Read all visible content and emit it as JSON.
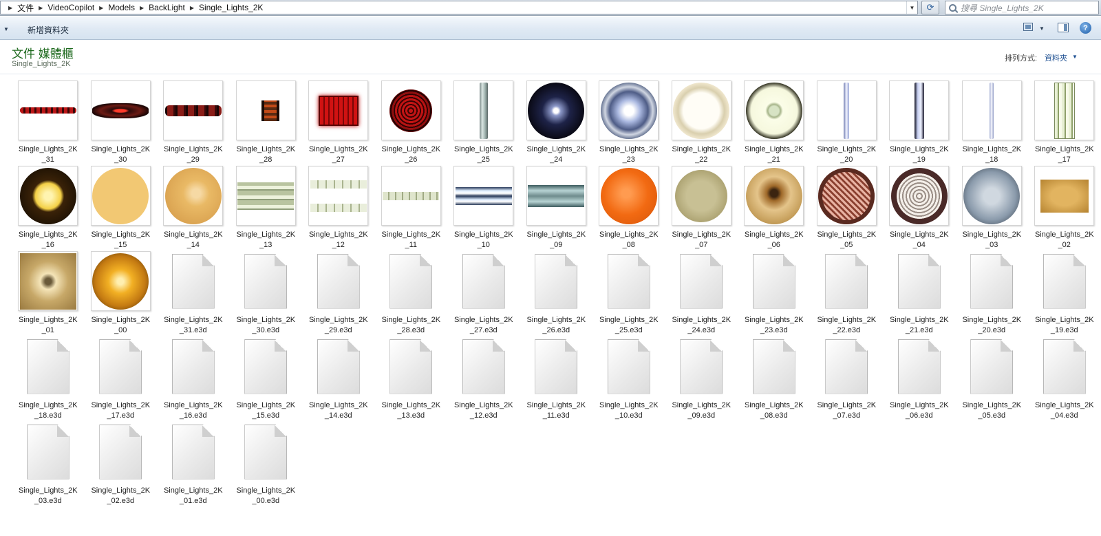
{
  "address_bar": {
    "crumbs": [
      "文件",
      "VideoCopilot",
      "Models",
      "BackLight",
      "Single_Lights_2K"
    ],
    "search_placeholder": "搜尋 Single_Lights_2K"
  },
  "toolbar": {
    "new_folder_label": "新增資料夾"
  },
  "library": {
    "title": "文件 媒體櫃",
    "subtitle": "Single_Lights_2K",
    "arrange_label": "排列方式:",
    "arrange_value": "資料夾"
  },
  "files": [
    {
      "label": "Single_Lights_2K\n_31",
      "thumb": "bar-red-dots"
    },
    {
      "label": "Single_Lights_2K\n_30",
      "thumb": "bar-red-oval"
    },
    {
      "label": "Single_Lights_2K\n_29",
      "thumb": "bar-red-segments"
    },
    {
      "label": "Single_Lights_2K\n_28",
      "thumb": "small-red-block"
    },
    {
      "label": "Single_Lights_2K\n_27",
      "thumb": "red-panel"
    },
    {
      "label": "Single_Lights_2K\n_26",
      "thumb": "red-circle"
    },
    {
      "label": "Single_Lights_2K\n_25",
      "thumb": "tube-vertical-teal"
    },
    {
      "label": "Single_Lights_2K\n_24",
      "thumb": "dark-blue-circle"
    },
    {
      "label": "Single_Lights_2K\n_23",
      "thumb": "blue-ring-circle"
    },
    {
      "label": "Single_Lights_2K\n_22",
      "thumb": "beige-ring-circle"
    },
    {
      "label": "Single_Lights_2K\n_21",
      "thumb": "dark-ring-green-circle"
    },
    {
      "label": "Single_Lights_2K\n_20",
      "thumb": "tube-vertical-blue"
    },
    {
      "label": "Single_Lights_2K\n_19",
      "thumb": "tube-vertical-dark"
    },
    {
      "label": "Single_Lights_2K\n_18",
      "thumb": "tube-vertical-thin"
    },
    {
      "label": "Single_Lights_2K\n_17",
      "thumb": "tube-vertical-green-panel"
    },
    {
      "label": "Single_Lights_2K\n_16",
      "thumb": "dark-yellow-circle"
    },
    {
      "label": "Single_Lights_2K\n_15",
      "thumb": "tan-circle"
    },
    {
      "label": "Single_Lights_2K\n_14",
      "thumb": "tan-circle-dots"
    },
    {
      "label": "Single_Lights_2K\n_13",
      "thumb": "triple-tube-panel"
    },
    {
      "label": "Single_Lights_2K\n_12",
      "thumb": "double-tube-panel"
    },
    {
      "label": "Single_Lights_2K\n_11",
      "thumb": "single-tube-panel"
    },
    {
      "label": "Single_Lights_2K\n_10",
      "thumb": "blue-double-tube"
    },
    {
      "label": "Single_Lights_2K\n_09",
      "thumb": "teal-double-tube"
    },
    {
      "label": "Single_Lights_2K\n_08",
      "thumb": "orange-circle"
    },
    {
      "label": "Single_Lights_2K\n_07",
      "thumb": "olive-circle"
    },
    {
      "label": "Single_Lights_2K\n_06",
      "thumb": "amber-glass-circle"
    },
    {
      "label": "Single_Lights_2K\n_05",
      "thumb": "striped-circle"
    },
    {
      "label": "Single_Lights_2K\n_04",
      "thumb": "concentric-circle"
    },
    {
      "label": "Single_Lights_2K\n_03",
      "thumb": "grey-blue-circle"
    },
    {
      "label": "Single_Lights_2K\n_02",
      "thumb": "gold-rectangle"
    },
    {
      "label": "Single_Lights_2K\n_01",
      "thumb": "reflector-square"
    },
    {
      "label": "Single_Lights_2K\n_00",
      "thumb": "amber-glow-circle"
    },
    {
      "label": "Single_Lights_2K\n_31.e3d",
      "thumb": "doc"
    },
    {
      "label": "Single_Lights_2K\n_30.e3d",
      "thumb": "doc"
    },
    {
      "label": "Single_Lights_2K\n_29.e3d",
      "thumb": "doc"
    },
    {
      "label": "Single_Lights_2K\n_28.e3d",
      "thumb": "doc"
    },
    {
      "label": "Single_Lights_2K\n_27.e3d",
      "thumb": "doc"
    },
    {
      "label": "Single_Lights_2K\n_26.e3d",
      "thumb": "doc"
    },
    {
      "label": "Single_Lights_2K\n_25.e3d",
      "thumb": "doc"
    },
    {
      "label": "Single_Lights_2K\n_24.e3d",
      "thumb": "doc"
    },
    {
      "label": "Single_Lights_2K\n_23.e3d",
      "thumb": "doc"
    },
    {
      "label": "Single_Lights_2K\n_22.e3d",
      "thumb": "doc"
    },
    {
      "label": "Single_Lights_2K\n_21.e3d",
      "thumb": "doc"
    },
    {
      "label": "Single_Lights_2K\n_20.e3d",
      "thumb": "doc"
    },
    {
      "label": "Single_Lights_2K\n_19.e3d",
      "thumb": "doc"
    },
    {
      "label": "Single_Lights_2K\n_18.e3d",
      "thumb": "doc"
    },
    {
      "label": "Single_Lights_2K\n_17.e3d",
      "thumb": "doc"
    },
    {
      "label": "Single_Lights_2K\n_16.e3d",
      "thumb": "doc"
    },
    {
      "label": "Single_Lights_2K\n_15.e3d",
      "thumb": "doc"
    },
    {
      "label": "Single_Lights_2K\n_14.e3d",
      "thumb": "doc"
    },
    {
      "label": "Single_Lights_2K\n_13.e3d",
      "thumb": "doc"
    },
    {
      "label": "Single_Lights_2K\n_12.e3d",
      "thumb": "doc"
    },
    {
      "label": "Single_Lights_2K\n_11.e3d",
      "thumb": "doc"
    },
    {
      "label": "Single_Lights_2K\n_10.e3d",
      "thumb": "doc"
    },
    {
      "label": "Single_Lights_2K\n_09.e3d",
      "thumb": "doc"
    },
    {
      "label": "Single_Lights_2K\n_08.e3d",
      "thumb": "doc"
    },
    {
      "label": "Single_Lights_2K\n_07.e3d",
      "thumb": "doc"
    },
    {
      "label": "Single_Lights_2K\n_06.e3d",
      "thumb": "doc"
    },
    {
      "label": "Single_Lights_2K\n_05.e3d",
      "thumb": "doc"
    },
    {
      "label": "Single_Lights_2K\n_04.e3d",
      "thumb": "doc"
    },
    {
      "label": "Single_Lights_2K\n_03.e3d",
      "thumb": "doc"
    },
    {
      "label": "Single_Lights_2K\n_02.e3d",
      "thumb": "doc"
    },
    {
      "label": "Single_Lights_2K\n_01.e3d",
      "thumb": "doc"
    },
    {
      "label": "Single_Lights_2K\n_00.e3d",
      "thumb": "doc"
    }
  ]
}
